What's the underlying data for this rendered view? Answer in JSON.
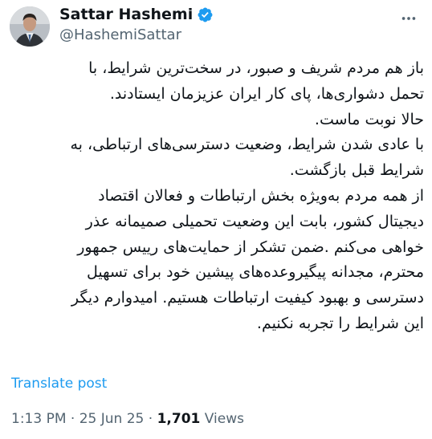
{
  "author": {
    "display_name": "Sattar Hashemi",
    "handle": "@HashemiSattar",
    "verified_badge_color": "#1d9bf0"
  },
  "post": {
    "lines": [
      "باز هم مردم شریف و صبور، در سخت‌ترین شرایط، با",
      "تحمل دشواری‌ها، پای کار ایران عزیزمان ایستادند.",
      "حالا نوبت ماست.",
      "با عادی شدن شرایط، وضعیت دسترسی‌های ارتباطی، به",
      "شرایط قبل بازگشت.",
      "از همه مردم به‌ویژه بخش ارتباطات و فعالان اقتصاد",
      "دیجیتال کشور، بابت این وضعیت تحمیلی صمیمانه عذر",
      "خواهی می‌کنم .ضمن تشکر از حمایت‌های رییس جمهور",
      "محترم، مجدانه پیگیروعده‌های پیشین خود برای تسهیل",
      "دسترسی و بهبود کیفیت ارتباطات هستیم. امیدوارم دیگر",
      "این شرایط را تجربه نکنیم."
    ],
    "translate_label": "Translate post",
    "time": "1:13 PM",
    "date": "25 Jun 25",
    "views_count": "1,701",
    "views_label": "Views",
    "separator": "·"
  },
  "icons": {
    "verified": "verified-badge-icon",
    "more": "more-options-icon"
  }
}
